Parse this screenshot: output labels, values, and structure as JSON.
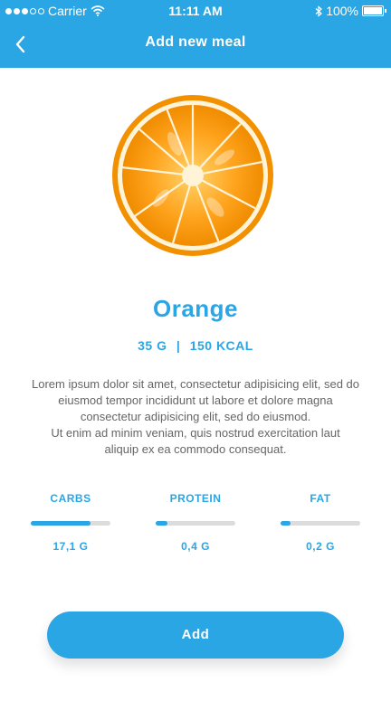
{
  "status_bar": {
    "carrier": "Carrier",
    "time": "11:11 AM",
    "battery": "100%",
    "signal_icon": "signal-dots-icon",
    "wifi_icon": "wifi-icon",
    "bluetooth_icon": "bluetooth-icon",
    "battery_icon": "battery-icon"
  },
  "header": {
    "title": "Add new meal",
    "back_icon": "chevron-left-icon",
    "background": "#2aa6e4"
  },
  "meal": {
    "image_icon": "orange-slice-image",
    "name": "Orange",
    "weight": "35 G",
    "separator": "|",
    "calories": "150 KCAL",
    "description_lines": [
      "Lorem ipsum dolor sit amet, consectetur adipisicing elit, sed do",
      "eiusmod tempor incididunt ut labore et dolore magna",
      "consectetur adipisicing elit, sed do eiusmod.",
      "Ut enim ad minim veniam, quis nostrud exercitation laut",
      "aliquip ex ea commodo consequat."
    ]
  },
  "macros": [
    {
      "label": "CARBS",
      "value": "17,1 G",
      "progress": 0.75
    },
    {
      "label": "PROTEIN",
      "value": "0,4 G",
      "progress": 0.15
    },
    {
      "label": "FAT",
      "value": "0,2 G",
      "progress": 0.12
    }
  ],
  "actions": {
    "add_label": "Add"
  },
  "colors": {
    "accent": "#2aa6e4",
    "track": "#dcdcdc",
    "text_muted": "#666666"
  }
}
